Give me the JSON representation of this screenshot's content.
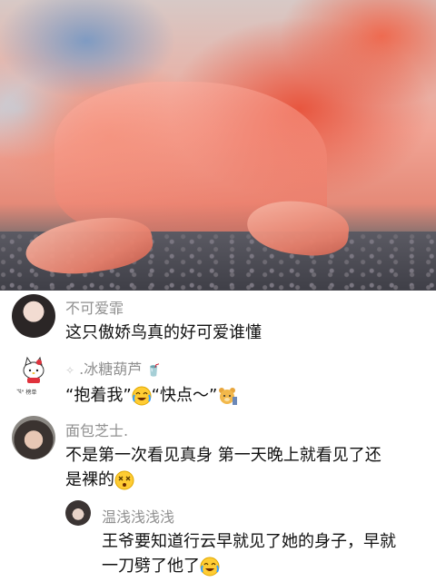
{
  "comments": [
    {
      "username": "不可爱霏",
      "text": "这只傲娇鸟真的好可爱谁懂"
    },
    {
      "username": ".冰糖葫芦",
      "username_prefix_emoji": "sparkle-icon",
      "username_suffix_emoji": "drink-icon",
      "text_part1": "“抱着我”",
      "text_part2": "“快点～”",
      "emoji1": "crying-laughing-emoji",
      "emoji2": "bear-emoji",
      "avatar_caption": "\"猫\" 榜单"
    },
    {
      "username": "面包芝士.",
      "text_line1": "不是第一次看见真身 第一天晚上就看见了还",
      "text_line2": "是裸的",
      "emoji": "dizzy-face-emoji"
    },
    {
      "username": "温浅浅浅浅",
      "text_line1": "王爷要知道行云早就见了她的身子，早就",
      "text_line2": "一刀劈了他了",
      "emoji": "crying-laughing-emoji"
    }
  ]
}
